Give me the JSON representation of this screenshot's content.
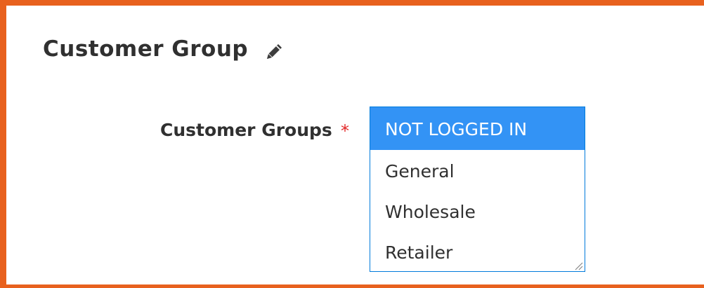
{
  "section": {
    "title": "Customer Group",
    "edit_icon": "pencil-icon"
  },
  "field": {
    "label": "Customer Groups",
    "required_marker": "*",
    "options": [
      {
        "label": "NOT LOGGED IN",
        "selected": true
      },
      {
        "label": "General",
        "selected": false
      },
      {
        "label": "Wholesale",
        "selected": false
      },
      {
        "label": "Retailer",
        "selected": false
      }
    ]
  },
  "colors": {
    "frame_border": "#e8611e",
    "selected_bg": "#3393f5",
    "select_border": "#007bdb",
    "required": "#e22626",
    "text": "#303030"
  }
}
